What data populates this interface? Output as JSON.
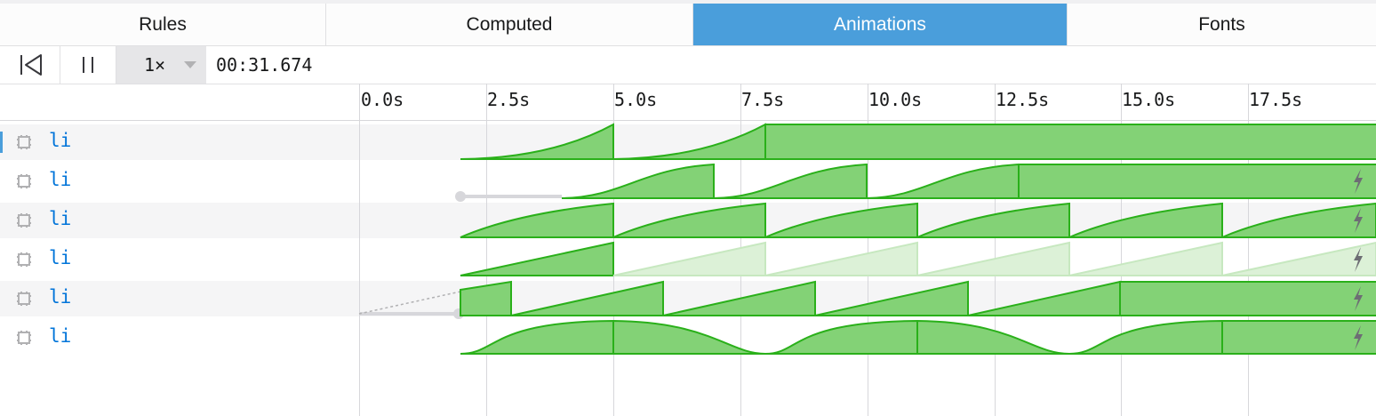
{
  "tabs": [
    {
      "label": "Rules"
    },
    {
      "label": "Computed"
    },
    {
      "label": "Animations",
      "active": true
    },
    {
      "label": "Fonts"
    }
  ],
  "toolbar": {
    "rewind_icon": "rewind-to-start-icon",
    "pause_icon": "pause-icon",
    "rate": "1×",
    "current_time": "00:31.674"
  },
  "timeline": {
    "ticks": [
      "0.0s",
      "2.5s",
      "5.0s",
      "7.5s",
      "10.0s",
      "12.5s",
      "15.0s",
      "17.5s"
    ]
  },
  "animations": [
    {
      "name": "li",
      "icon": "element-node-icon",
      "selected": true
    },
    {
      "name": "li",
      "icon": "element-node-icon",
      "compositor_icon": "lightning-icon"
    },
    {
      "name": "li",
      "icon": "element-node-icon",
      "compositor_icon": "lightning-icon"
    },
    {
      "name": "li",
      "icon": "element-node-icon",
      "compositor_icon": "lightning-icon"
    },
    {
      "name": "li",
      "icon": "element-node-icon",
      "compositor_icon": "lightning-icon"
    },
    {
      "name": "li",
      "icon": "element-node-icon",
      "compositor_icon": "lightning-icon"
    }
  ],
  "colors": {
    "accent": "#4a9edb",
    "animation_fill": "#83d276",
    "animation_stroke": "#2ab01a",
    "delay_line": "#d7d7db",
    "node_name": "#0074d9"
  }
}
